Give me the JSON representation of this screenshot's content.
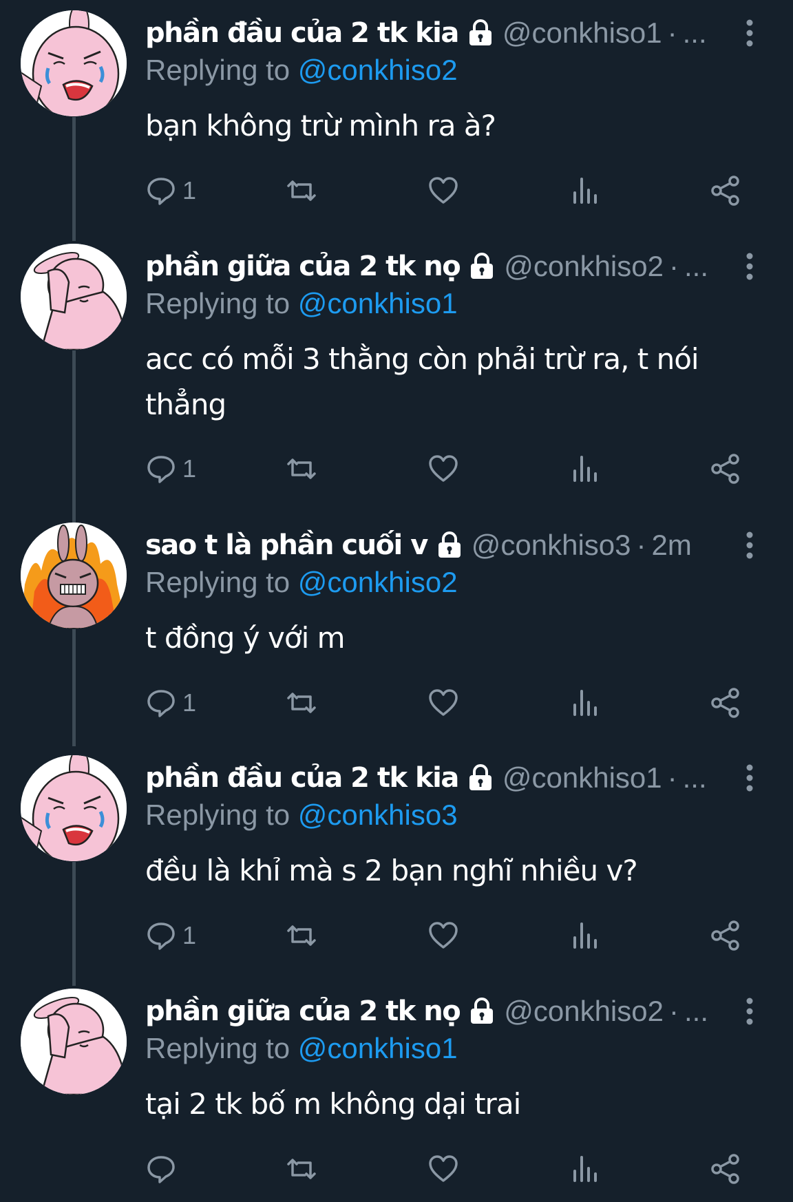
{
  "colors": {
    "background": "#15202b",
    "text_primary": "#ffffff",
    "text_secondary": "#8b98a5",
    "link": "#1d9bf0",
    "thread_line": "#3d4a55"
  },
  "icons": {
    "protected": "lock-icon",
    "more": "more-vertical-icon",
    "reply": "comment-icon",
    "retweet": "retweet-icon",
    "like": "heart-icon",
    "views": "analytics-icon",
    "share": "share-icon"
  },
  "tweets": [
    {
      "name": "phần đầu của 2 tk kia",
      "handle": "@conkhiso1",
      "dot": "·",
      "time": "...",
      "replying_prefix": "Replying to ",
      "replying_to": "@conkhiso2",
      "text": "bạn không trừ mình ra à?",
      "reply_count": "1",
      "avatar": "crying-bunny"
    },
    {
      "name": "phần giữa của 2 tk nọ",
      "handle": "@conkhiso2",
      "dot": "·",
      "time": "...",
      "replying_prefix": "Replying to ",
      "replying_to": "@conkhiso1",
      "text": "acc có mỗi 3 thằng còn phải trừ ra, t nói thẳng",
      "reply_count": "1",
      "avatar": "facepalm-bunny"
    },
    {
      "name": "sao t là phần cuối v",
      "handle": "@conkhiso3",
      "dot": "·",
      "time": "2m",
      "replying_prefix": "Replying to ",
      "replying_to": "@conkhiso2",
      "text": "t đồng ý với m",
      "reply_count": "1",
      "avatar": "angry-fire-bunny"
    },
    {
      "name": "phần đầu của 2 tk kia",
      "handle": "@conkhiso1",
      "dot": "·",
      "time": "...",
      "replying_prefix": "Replying to ",
      "replying_to": "@conkhiso3",
      "text": "đều là khỉ mà s 2 bạn nghĩ nhiều v?",
      "reply_count": "1",
      "avatar": "crying-bunny"
    },
    {
      "name": "phần giữa của 2 tk nọ",
      "handle": "@conkhiso2",
      "dot": "·",
      "time": "...",
      "replying_prefix": "Replying to ",
      "replying_to": "@conkhiso1",
      "text": "tại 2 tk bố m không dại trai",
      "reply_count": "",
      "avatar": "facepalm-bunny"
    }
  ]
}
